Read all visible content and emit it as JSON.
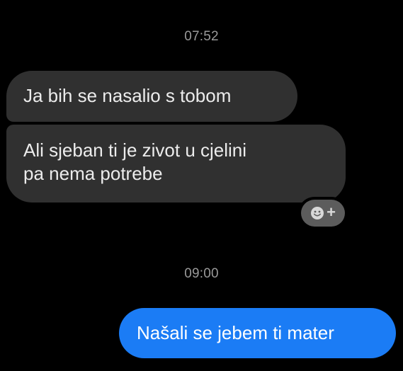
{
  "conversation": {
    "groups": [
      {
        "timestamp": "07:52",
        "messages": [
          {
            "direction": "incoming",
            "lines": [
              "Ja bih se nasalio s tobom"
            ]
          },
          {
            "direction": "incoming",
            "lines": [
              "Ali sjeban ti je zivot u cjelini",
              "pa nema potrebe"
            ]
          }
        ],
        "reaction_button": {
          "icon": "smiley-add-reaction-icon",
          "glyph": "+"
        }
      },
      {
        "timestamp": "09:00",
        "messages": [
          {
            "direction": "outgoing",
            "lines": [
              "Našali se jebem ti mater"
            ]
          }
        ]
      }
    ]
  },
  "colors": {
    "background": "#000000",
    "incoming_bubble": "#303030",
    "outgoing_bubble": "#1b7cf5",
    "timestamp_text": "#9a9a9a",
    "reaction_button": "#5c5c5c"
  }
}
